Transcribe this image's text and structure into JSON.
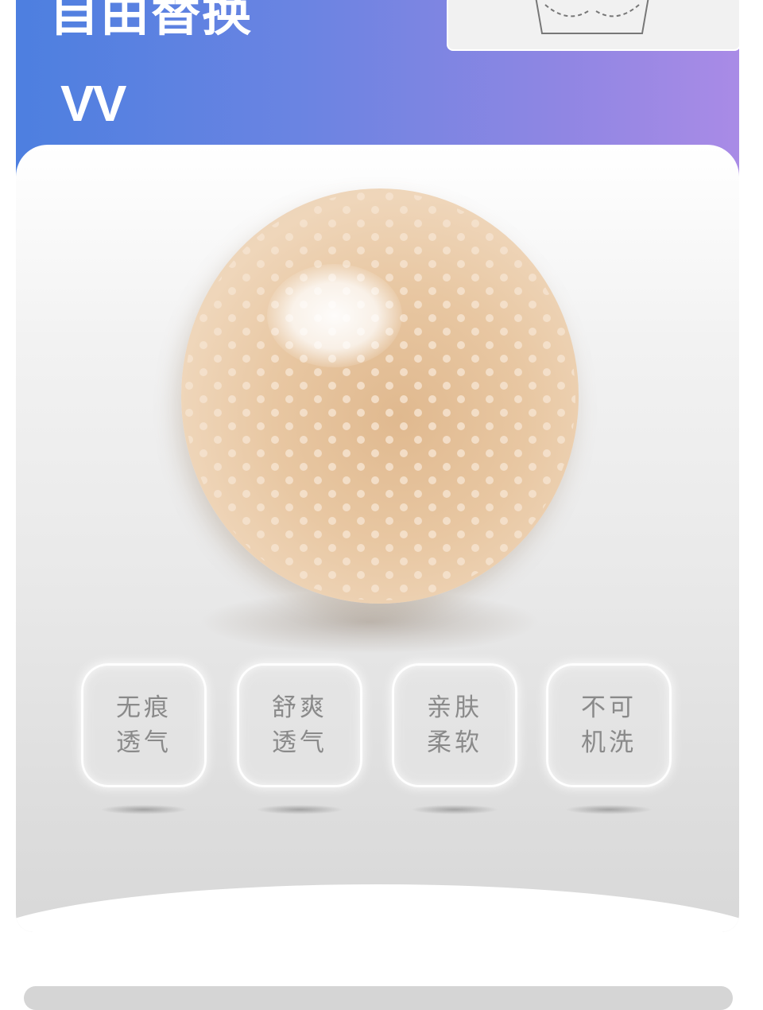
{
  "header": {
    "title": "自由替换",
    "subtitle": "VV"
  },
  "colors": {
    "banner_start": "#4d7fe0",
    "banner_end": "#a98be6",
    "pad": "#e8c7a2",
    "tile_text": "#8a8a8a"
  },
  "features": [
    {
      "label": "无痕透气"
    },
    {
      "label": "舒爽透气"
    },
    {
      "label": "亲肤柔软"
    },
    {
      "label": "不可机洗"
    }
  ]
}
